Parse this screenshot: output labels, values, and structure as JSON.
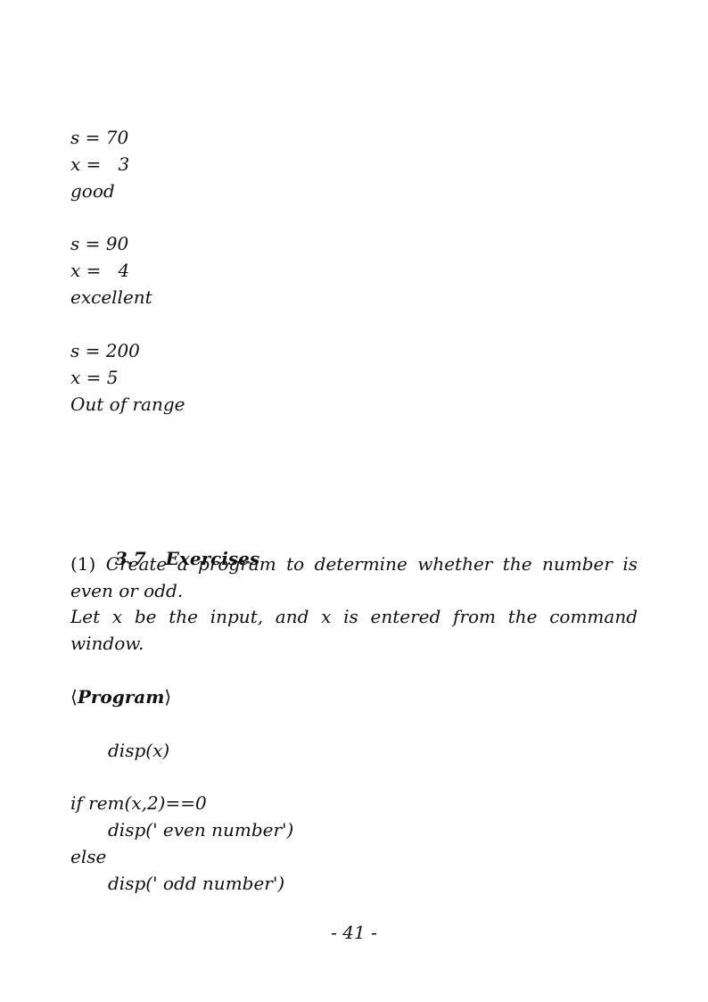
{
  "output_blocks": [
    {
      "s_line": "s = 70",
      "x_line": "x =   3",
      "result": "good"
    },
    {
      "s_line": "s = 90",
      "x_line": "x =   4",
      "result": "excellent"
    },
    {
      "s_line": "s = 200",
      "x_line": "x = 5",
      "result": "Out of range"
    }
  ],
  "section": {
    "number": "3.7",
    "title": "Exercises"
  },
  "exercise": {
    "marker": "(1)",
    "text_line1": " Create a program to determine whether the number is even or odd.",
    "text_line2": "Let x be the input, and x is entered from the command window."
  },
  "program": {
    "open_bracket": "⟨",
    "label": "Program",
    "close_bracket": "⟩",
    "code": [
      "disp(x)",
      "if rem(x,2)==0",
      "disp(' even number')",
      "else",
      "disp(' odd number')"
    ]
  },
  "page_number": "- 41 -"
}
